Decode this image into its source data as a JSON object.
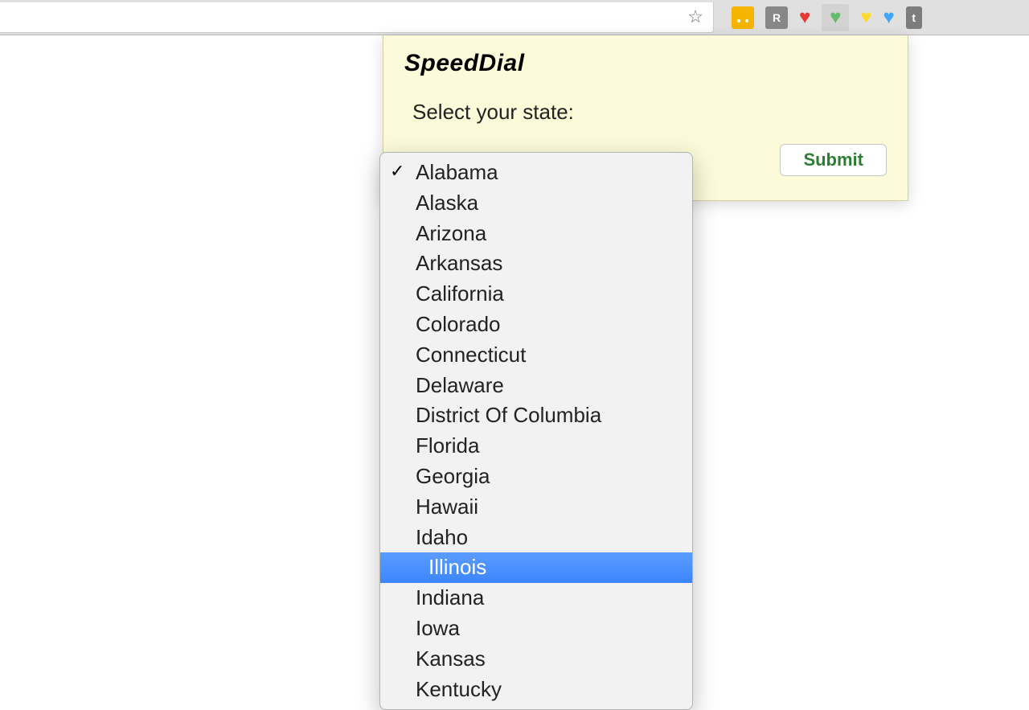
{
  "toolbar": {
    "extensions": [
      {
        "name": "ext-orange",
        "type": "orange",
        "label": ""
      },
      {
        "name": "ext-r",
        "type": "grayR",
        "label": "R"
      },
      {
        "name": "ext-heart-red",
        "type": "heart-red"
      },
      {
        "name": "ext-heart-green",
        "type": "heart-green"
      },
      {
        "name": "ext-heart-yellow",
        "type": "heart-yellow"
      },
      {
        "name": "ext-heart-blue",
        "type": "heart-blue"
      },
      {
        "name": "ext-t",
        "type": "grayT",
        "label": "t"
      }
    ]
  },
  "popup": {
    "title": "SpeedDial",
    "label": "Select your state:",
    "submit_label": "Submit"
  },
  "dropdown": {
    "options": [
      {
        "label": "Alabama",
        "checked": true,
        "highlighted": false
      },
      {
        "label": "Alaska",
        "checked": false,
        "highlighted": false
      },
      {
        "label": "Arizona",
        "checked": false,
        "highlighted": false
      },
      {
        "label": "Arkansas",
        "checked": false,
        "highlighted": false
      },
      {
        "label": "California",
        "checked": false,
        "highlighted": false
      },
      {
        "label": "Colorado",
        "checked": false,
        "highlighted": false
      },
      {
        "label": "Connecticut",
        "checked": false,
        "highlighted": false
      },
      {
        "label": "Delaware",
        "checked": false,
        "highlighted": false
      },
      {
        "label": "District Of Columbia",
        "checked": false,
        "highlighted": false
      },
      {
        "label": "Florida",
        "checked": false,
        "highlighted": false
      },
      {
        "label": "Georgia",
        "checked": false,
        "highlighted": false
      },
      {
        "label": "Hawaii",
        "checked": false,
        "highlighted": false
      },
      {
        "label": "Idaho",
        "checked": false,
        "highlighted": false
      },
      {
        "label": "Illinois",
        "checked": false,
        "highlighted": true
      },
      {
        "label": "Indiana",
        "checked": false,
        "highlighted": false
      },
      {
        "label": "Iowa",
        "checked": false,
        "highlighted": false
      },
      {
        "label": "Kansas",
        "checked": false,
        "highlighted": false
      },
      {
        "label": "Kentucky",
        "checked": false,
        "highlighted": false
      }
    ]
  }
}
